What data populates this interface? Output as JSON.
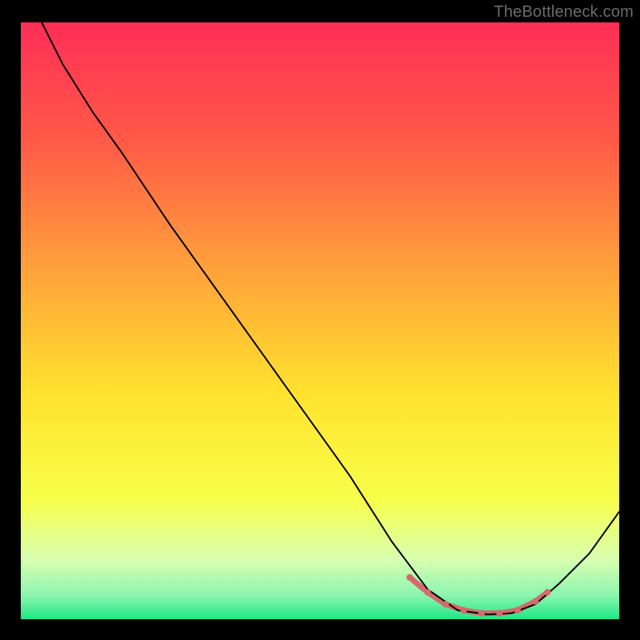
{
  "attribution": "TheBottleneck.com",
  "chart_data": {
    "type": "line",
    "title": "",
    "xlabel": "",
    "ylabel": "",
    "xlim": [
      0,
      100
    ],
    "ylim": [
      0,
      100
    ],
    "grid": false,
    "background_gradient_stops": [
      {
        "offset": 0.0,
        "color": "#ff2e57"
      },
      {
        "offset": 0.2,
        "color": "#ff5a47"
      },
      {
        "offset": 0.42,
        "color": "#ffa43a"
      },
      {
        "offset": 0.62,
        "color": "#ffe22e"
      },
      {
        "offset": 0.8,
        "color": "#f7ff4a"
      },
      {
        "offset": 0.9,
        "color": "#d8ffb0"
      },
      {
        "offset": 0.96,
        "color": "#8cf5b0"
      },
      {
        "offset": 1.0,
        "color": "#1ee884"
      }
    ],
    "series": [
      {
        "name": "curve",
        "stroke": "#000000",
        "stroke_width": 2.0,
        "points": [
          {
            "x": 3.5,
            "y": 100.0
          },
          {
            "x": 7.0,
            "y": 93.0
          },
          {
            "x": 12.0,
            "y": 85.0
          },
          {
            "x": 17.0,
            "y": 78.0
          },
          {
            "x": 25.0,
            "y": 66.0
          },
          {
            "x": 35.0,
            "y": 52.0
          },
          {
            "x": 45.0,
            "y": 38.0
          },
          {
            "x": 55.0,
            "y": 24.0
          },
          {
            "x": 62.0,
            "y": 13.0
          },
          {
            "x": 68.0,
            "y": 5.0
          },
          {
            "x": 73.0,
            "y": 1.5
          },
          {
            "x": 78.0,
            "y": 0.8
          },
          {
            "x": 82.0,
            "y": 1.0
          },
          {
            "x": 86.0,
            "y": 2.5
          },
          {
            "x": 90.0,
            "y": 6.0
          },
          {
            "x": 95.0,
            "y": 11.0
          },
          {
            "x": 100.0,
            "y": 18.0
          }
        ]
      },
      {
        "name": "valley-highlight",
        "stroke": "#d56a6a",
        "stroke_width": 7.0,
        "points": [
          {
            "x": 65.0,
            "y": 7.0
          },
          {
            "x": 68.0,
            "y": 4.5
          },
          {
            "x": 71.0,
            "y": 2.5
          },
          {
            "x": 74.0,
            "y": 1.5
          },
          {
            "x": 77.0,
            "y": 1.0
          },
          {
            "x": 80.0,
            "y": 1.0
          },
          {
            "x": 83.0,
            "y": 1.5
          },
          {
            "x": 86.0,
            "y": 3.0
          },
          {
            "x": 88.0,
            "y": 4.5
          }
        ]
      }
    ],
    "markers": {
      "series": "valley-highlight",
      "shape": "circle",
      "radius": 4.2,
      "fill": "#d56a6a",
      "x": [
        65,
        68,
        71,
        74,
        77,
        80,
        83,
        86,
        88
      ]
    }
  }
}
